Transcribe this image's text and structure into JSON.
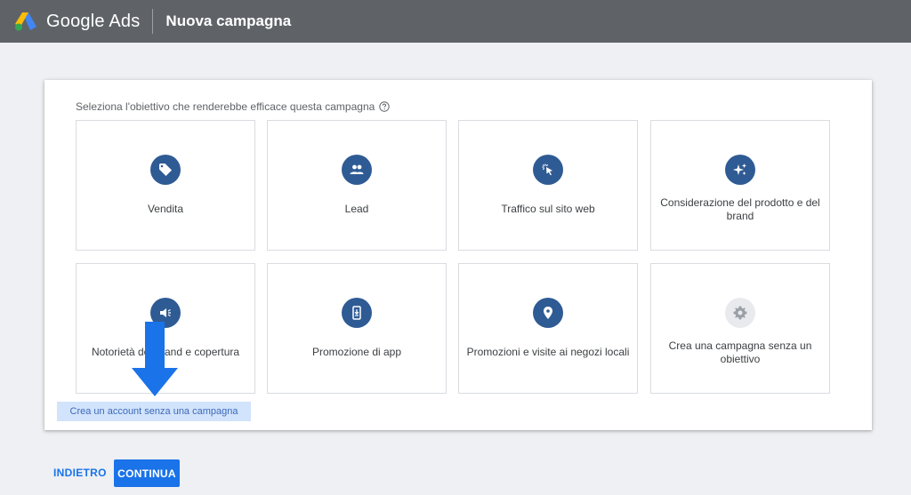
{
  "header": {
    "product_name": "Google Ads",
    "page_title": "Nuova campagna"
  },
  "objective": {
    "prompt": "Seleziona l'obiettivo che renderebbe efficace questa campagna",
    "tiles": [
      {
        "label": "Vendita",
        "icon": "tag-icon"
      },
      {
        "label": "Lead",
        "icon": "people-icon"
      },
      {
        "label": "Traffico sul sito web",
        "icon": "cursor-click-icon"
      },
      {
        "label": "Considerazione del prodotto e del brand",
        "icon": "sparkle-icon"
      },
      {
        "label": "Notorietà del brand e copertura",
        "icon": "megaphone-icon"
      },
      {
        "label": "Promozione di app",
        "icon": "phone-download-icon"
      },
      {
        "label": "Promozioni e visite ai negozi locali",
        "icon": "location-pin-icon"
      },
      {
        "label": "Crea una campagna senza un obiettivo",
        "icon": "gear-icon"
      }
    ],
    "no_campaign_link": "Crea un account senza una campagna"
  },
  "footer": {
    "back_label": "INDIETRO",
    "continue_label": "CONTINUA"
  },
  "colors": {
    "header_bg": "#5f6368",
    "icon_circle": "#2f5b94",
    "primary": "#1a73e8",
    "annotation_arrow": "#1a73e8",
    "link_highlight": "#d2e3fc"
  }
}
